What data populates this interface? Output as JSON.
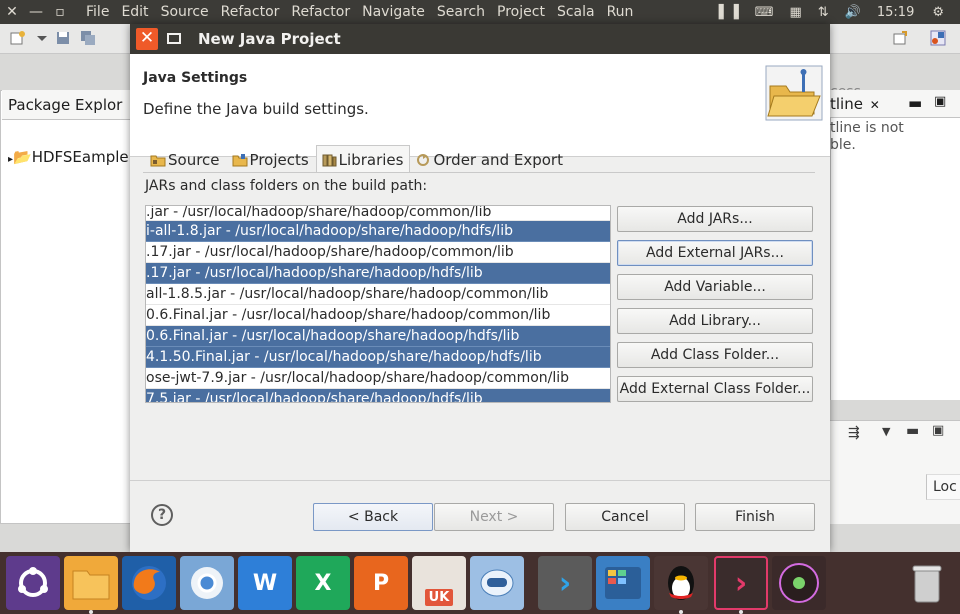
{
  "topbar": {
    "menu": [
      "File",
      "Edit",
      "Source",
      "Refactor",
      "Refactor",
      "Navigate",
      "Search",
      "Project",
      "Scala",
      "Run"
    ],
    "clock": "15:19"
  },
  "eclipse": {
    "package_explorer_tab": "Package Explor",
    "project_name": "HDFSEample",
    "outline_tab": "tline",
    "outline_msg_line1": "tline is not",
    "outline_msg_line2": "ble.",
    "access_text": "cess",
    "loc_header": "Loc"
  },
  "dialog": {
    "title": "New Java Project",
    "header_title": "Java Settings",
    "header_desc": "Define the Java build settings.",
    "tabs": [
      {
        "label": "Source"
      },
      {
        "label": "Projects"
      },
      {
        "label": "Libraries"
      },
      {
        "label": "Order and Export"
      }
    ],
    "build_path_label": "JARs and class folders on the build path:",
    "jars": [
      {
        "text": ".jar - /usr/local/hadoop/share/hadoop/common/lib",
        "selected": false
      },
      {
        "text": "i-all-1.8.jar - /usr/local/hadoop/share/hadoop/hdfs/lib",
        "selected": true
      },
      {
        "text": ".17.jar - /usr/local/hadoop/share/hadoop/common/lib",
        "selected": false
      },
      {
        "text": ".17.jar - /usr/local/hadoop/share/hadoop/hdfs/lib",
        "selected": true
      },
      {
        "text": "all-1.8.5.jar - /usr/local/hadoop/share/hadoop/common/lib",
        "selected": false
      },
      {
        "text": "0.6.Final.jar - /usr/local/hadoop/share/hadoop/common/lib",
        "selected": false
      },
      {
        "text": "0.6.Final.jar - /usr/local/hadoop/share/hadoop/hdfs/lib",
        "selected": true
      },
      {
        "text": "4.1.50.Final.jar - /usr/local/hadoop/share/hadoop/hdfs/lib",
        "selected": true
      },
      {
        "text": "ose-jwt-7.9.jar - /usr/local/hadoop/share/hadoop/common/lib",
        "selected": false
      },
      {
        "text": "7.5.jar - /usr/local/hadoop/share/hadoop/hdfs/lib",
        "selected": true
      }
    ],
    "buttons": {
      "add_jars": "Add JARs...",
      "add_external_jars": "Add External JARs...",
      "add_variable": "Add Variable...",
      "add_library": "Add Library...",
      "add_class_folder": "Add Class Folder...",
      "add_external_class_folder": "Add External Class Folder..."
    },
    "footer": {
      "help": "?",
      "back": "< Back",
      "next": "Next >",
      "cancel": "Cancel",
      "finish": "Finish"
    }
  },
  "dock": {
    "items": [
      "ubuntu-launcher",
      "files",
      "firefox",
      "chromium",
      "wps-writer",
      "wps-spreadsheets",
      "wps-presentation",
      "ubuntu-software",
      "app-store",
      "vscode",
      "workspace",
      "qq",
      "terminal",
      "media-player",
      "trash"
    ],
    "wps_writer_glyph": "W",
    "wps_sheets_glyph": "X",
    "wps_presentation_glyph": "P",
    "software_badge": "UK",
    "vscode_glyph": "›",
    "terminal_glyph": "›"
  }
}
